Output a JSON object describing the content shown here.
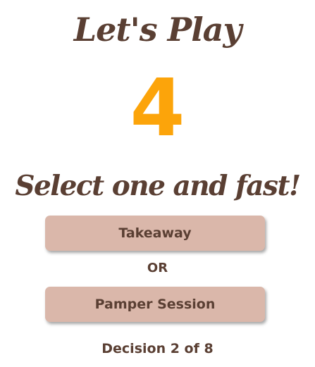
{
  "header": {
    "title": "Let's Play"
  },
  "countdown": {
    "value": "4"
  },
  "prompt": {
    "text": "Select one and fast!"
  },
  "choices": [
    {
      "label": "Takeaway"
    },
    {
      "label": "Pamper Session"
    }
  ],
  "separator": {
    "label": "OR"
  },
  "progress": {
    "text": "Decision 2 of 8"
  },
  "colors": {
    "text_brown": "#5a3f33",
    "countdown_orange": "#fca40a",
    "button_bg": "#dab7aa",
    "background": "#ffffff"
  }
}
